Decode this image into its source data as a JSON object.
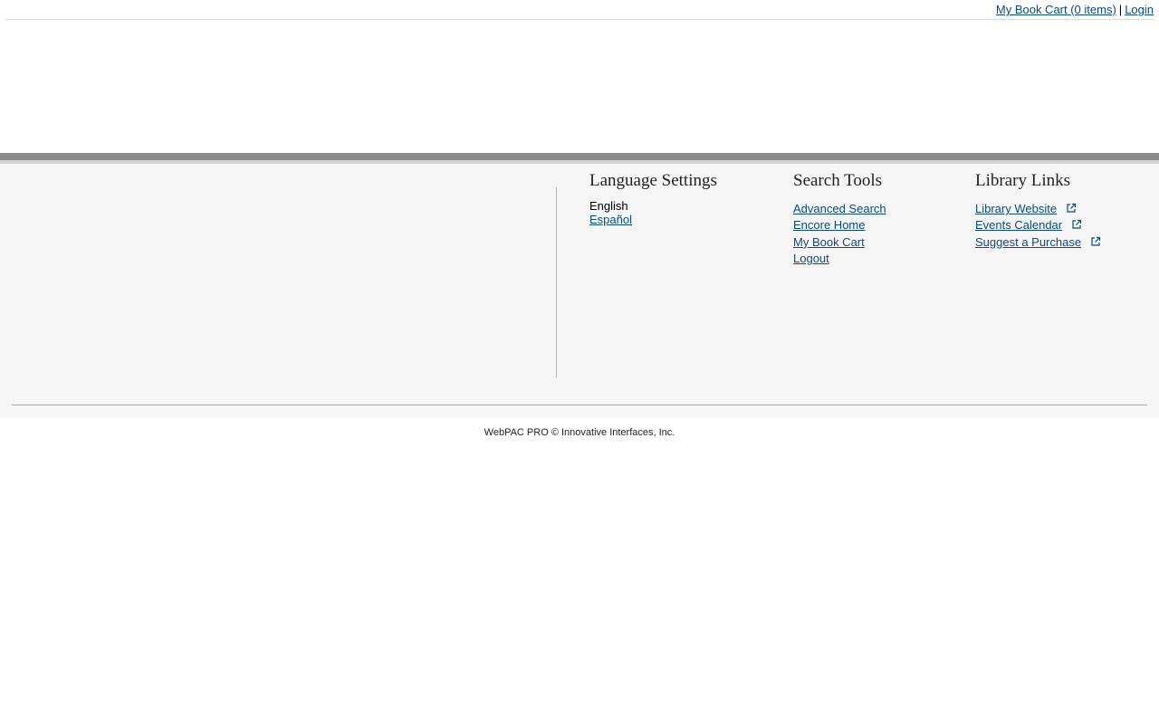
{
  "topbar": {
    "cart_link": "My Book Cart (0 items)",
    "separator": "|",
    "login_link": "Login"
  },
  "language": {
    "heading": "Language Settings",
    "current": "English",
    "alternate": "Español"
  },
  "search_tools": {
    "heading": "Search Tools",
    "items": [
      "Advanced Search",
      "Encore Home",
      "My Book Cart",
      "Logout"
    ]
  },
  "library_links": {
    "heading": "Library Links",
    "items": [
      "Library Website",
      "Events Calendar",
      "Suggest a Purchase"
    ],
    "icon": "external-link-icon"
  },
  "footer": {
    "copyright": "WebPAC PRO © Innovative Interfaces, Inc."
  },
  "colors": {
    "link": "#0a4a86",
    "panel_bg": "#f6f6f6",
    "band": "#8c8c8c"
  }
}
